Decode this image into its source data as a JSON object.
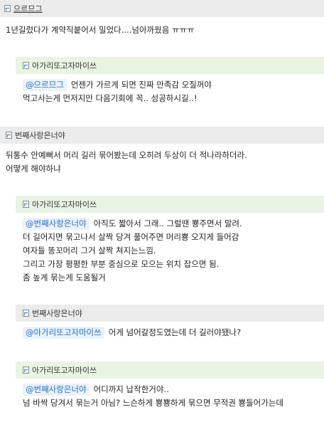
{
  "comments": [
    {
      "author": "으르므그",
      "lines": [
        "1년길렀다가 계약직붙어서 밀었다....넘아까웠음 ㅠㅠㅠ"
      ]
    },
    {
      "author": "아가리또고자마이쓰",
      "mention": "@으르므그",
      "lines": [
        "언젠가 가르게 되면 진짜 만족감 오질꺼야",
        "먹고사는게 먼저지만 다음기회에 꼭.. 성공하시길..!"
      ]
    },
    {
      "author": "번째사랑은너야",
      "lines": [
        "뒤통수 안예뻐서 머리 길러 묶어봤는데 오히려 두상이 더 적나라하더라.",
        "어떻게 해야하냐"
      ]
    },
    {
      "author": "아가리또고자마이쓰",
      "mention": "@번째사랑은너야",
      "lines": [
        "아직도 짧아서 그래.. 그럴땐 뿅주면서 말려.",
        "더 길어지면 묶고나서 살짝 당겨 풀어주면 머리뿅 오지게 들어감",
        "여자들 똥꼬머리 그거 살짝 쳐지는느낌.",
        "그리고 가장 평평한 부분 중심으로 모으는 위치 잡으면 됨.",
        "좀 높게 묶는게 도움될거"
      ]
    },
    {
      "author": "번째사랑은너야",
      "mention": "@아가리또고자마이쓰",
      "lines": [
        "어게 넘어갈정도였는데 더 길러야됐나?"
      ]
    },
    {
      "author": "아가리또고자마이쓰",
      "mention": "@번째사랑은너야",
      "lines": [
        "어디까지 납작한거야..",
        "넘 바싹 당겨서 묶는거 아님? 느슨하게 뿅뿅하게 묶으면 무적권 뿅들어가는데"
      ]
    }
  ]
}
